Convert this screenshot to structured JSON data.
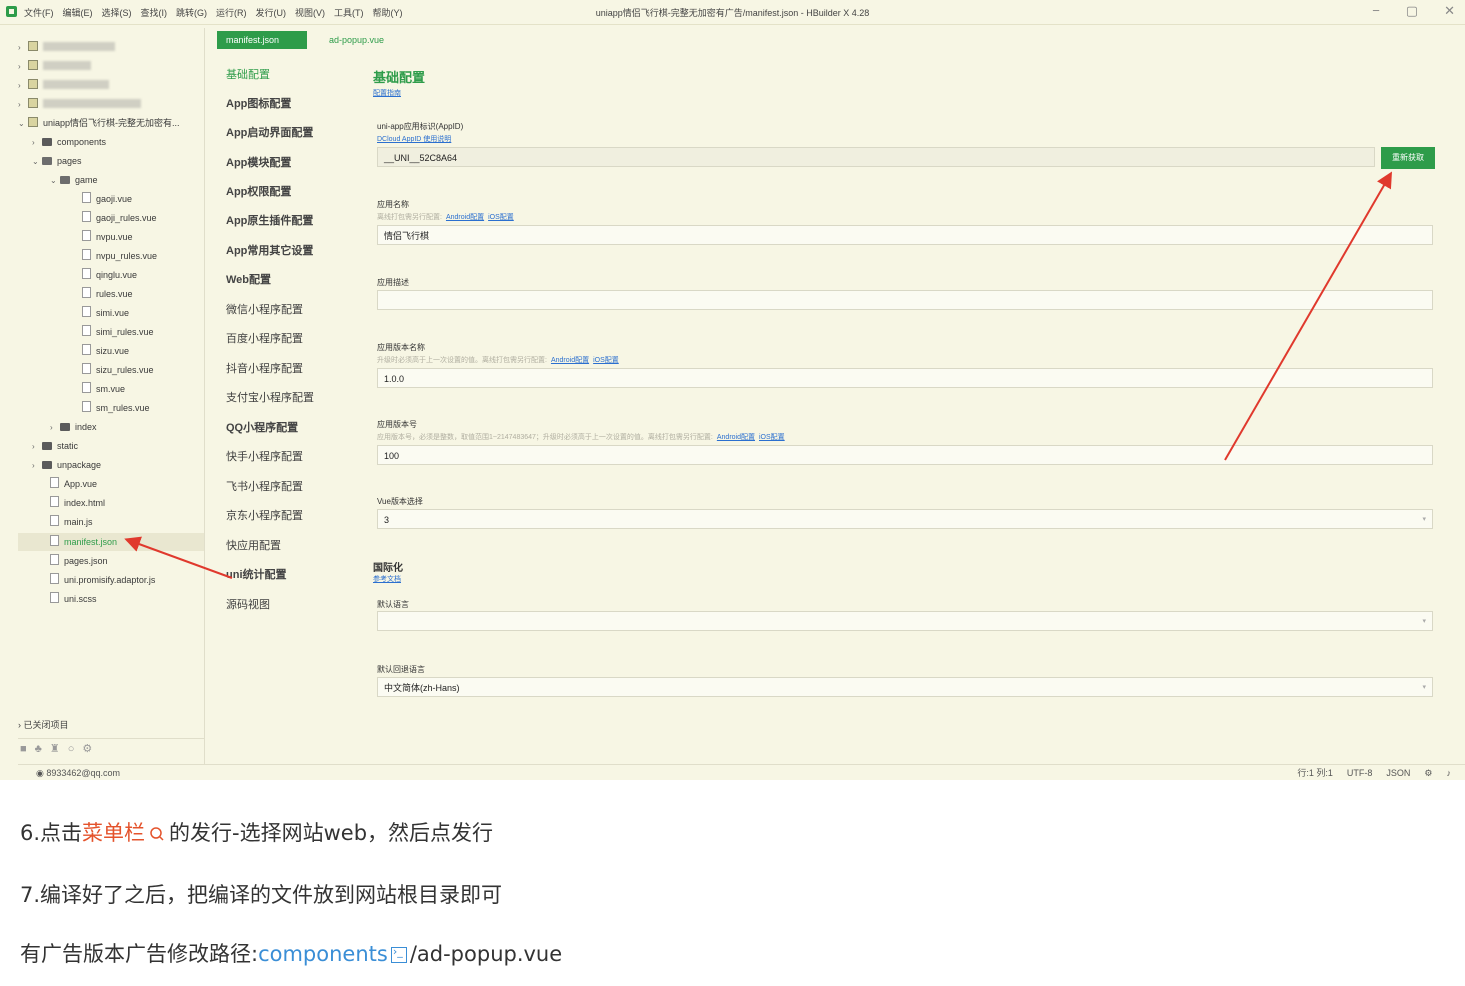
{
  "window": {
    "title": "uniapp情侣飞行棋-完整无加密有广告/manifest.json - HBuilder X 4.28",
    "menu": [
      "文件(F)",
      "编辑(E)",
      "选择(S)",
      "查找(I)",
      "跳转(G)",
      "运行(R)",
      "发行(U)",
      "视图(V)",
      "工具(T)",
      "帮助(Y)"
    ],
    "controls": [
      "−",
      "▢",
      "✕"
    ]
  },
  "tree": {
    "project": "uniapp情侣飞行棋-完整无加密有...",
    "components": "components",
    "pages": "pages",
    "game": "game",
    "game_files": [
      "gaoji.vue",
      "gaoji_rules.vue",
      "nvpu.vue",
      "nvpu_rules.vue",
      "qinglu.vue",
      "rules.vue",
      "simi.vue",
      "simi_rules.vue",
      "sizu.vue",
      "sizu_rules.vue",
      "sm.vue",
      "sm_rules.vue"
    ],
    "index": "index",
    "static": "static",
    "unpackage": "unpackage",
    "app_vue": "App.vue",
    "index_html": "index.html",
    "main_js": "main.js",
    "manifest": "manifest.json",
    "pages_json": "pages.json",
    "promisify": "uni.promisify.adaptor.js",
    "uni_scss": "uni.scss",
    "closed_projects": "已关闭项目"
  },
  "status": {
    "user": "8933462@qq.com",
    "position": "行:1  列:1",
    "encoding": "UTF-8",
    "language": "JSON"
  },
  "tabs": {
    "manifest": "manifest.json",
    "ad_popup": "ad-popup.vue"
  },
  "nav": [
    "基础配置",
    "App图标配置",
    "App启动界面配置",
    "App模块配置",
    "App权限配置",
    "App原生插件配置",
    "App常用其它设置",
    "Web配置",
    "微信小程序配置",
    "百度小程序配置",
    "抖音小程序配置",
    "支付宝小程序配置",
    "QQ小程序配置",
    "快手小程序配置",
    "飞书小程序配置",
    "京东小程序配置",
    "快应用配置",
    "uni统计配置",
    "源码视图"
  ],
  "form": {
    "heading": "基础配置",
    "guide_link": "配置指南",
    "appid_label": "uni-app应用标识(AppID)",
    "appid_link": "DCloud AppID 使用说明",
    "appid_value": "__UNI__52C8A64",
    "refetch_button": "重新获取",
    "name_label": "应用名称",
    "name_hint": "离线打包需另行配置:",
    "android_link": "Android配置",
    "ios_link": "iOS配置",
    "name_value": "情侣飞行棋",
    "desc_label": "应用描述",
    "desc_value": "",
    "version_name_label": "应用版本名称",
    "version_name_hint": "升级时必须高于上一次设置的值。离线打包需另行配置:",
    "version_name_value": "1.0.0",
    "version_code_label": "应用版本号",
    "version_code_hint": "应用版本号，必须是整数，取值范围1~2147483647；升级时必须高于上一次设置的值。离线打包需另行配置:",
    "version_code_value": "100",
    "vue_label": "Vue版本选择",
    "vue_value": "3",
    "i18n_heading": "国际化",
    "i18n_link": "参考文档",
    "default_lang_label": "默认语言",
    "default_lang_value": "",
    "fallback_lang_label": "默认回退语言",
    "fallback_lang_value": "中文简体(zh-Hans)"
  },
  "article": {
    "step6_prefix": "6.点击",
    "step6_highlight": "菜单栏",
    "step6_suffix": "的发行-选择网站web，然后点发行",
    "step7": "7.编译好了之后，把编译的文件放到网站根目录即可",
    "ad_prefix": "有广告版本广告修改路径:",
    "ad_link": "components",
    "ad_suffix": "/ad-popup.vue"
  },
  "colors": {
    "accent": "#2e9c4a",
    "arrow": "#e0392d",
    "highlight": "#e4532c",
    "link": "#3a8ed6"
  }
}
